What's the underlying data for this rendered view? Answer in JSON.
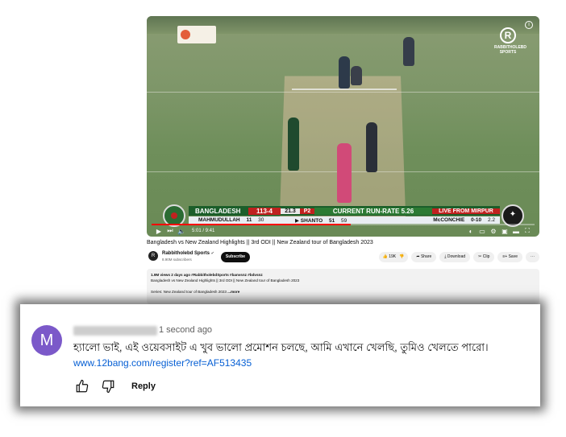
{
  "player": {
    "logo_right": "RABBITHOLEBD SPORTS",
    "info_icon": "i",
    "scoreboard": {
      "team": "BANGLADESH",
      "score": "113-4",
      "overs": "21.3",
      "powerplay": "P2",
      "run_rate_label": "CURRENT RUN-RATE",
      "run_rate": "5.26",
      "live_label": "LIVE FROM MIRPUR",
      "batter1": "MAHMUDULLAH",
      "batter1_score": "11",
      "batter1_balls": "30",
      "batter2": "▶ SHANTO",
      "batter2_score": "51",
      "batter2_balls": "59",
      "bowler": "McCONCHIE",
      "bowler_figures": "0-10",
      "bowler_overs": "2.2"
    },
    "time": "5:01 / 9:41",
    "progress": 0.52
  },
  "video": {
    "title": "Bangladesh vs New Zealand Highlights || 3rd ODI || New Zealand tour of Bangladesh 2023",
    "channel": "Rabbitholebd Sports",
    "subscribers": "8.90M subscribers",
    "subscribe_label": "Subscribe",
    "likes": "19K",
    "share_label": "Share",
    "download_label": "Download",
    "clip_label": "Clip",
    "save_label": "Save",
    "more_label": "···",
    "description": {
      "meta": "1.9M views  2 days ago  #RabbitholebdSports #banvsnz #bdvsnz",
      "line1": "Bangladesh vs New Zealand Highlights || 3rd ODI || New Zealand tour of Bangladesh 2023",
      "line2": "Series: New Zealand tour of Bangladesh 2023",
      "more": "...more"
    }
  },
  "comment": {
    "avatar_letter": "M",
    "time": "1 second ago",
    "text": "হ্যালো ভাই, এই ওয়েবসাইট এ খুব ভালো প্রমোশন চলছে, আমি এখানে খেলছি, তুমিও খেলতে পারো।",
    "link": "www.12bang.com/register?ref=AF513435",
    "reply_label": "Reply"
  }
}
